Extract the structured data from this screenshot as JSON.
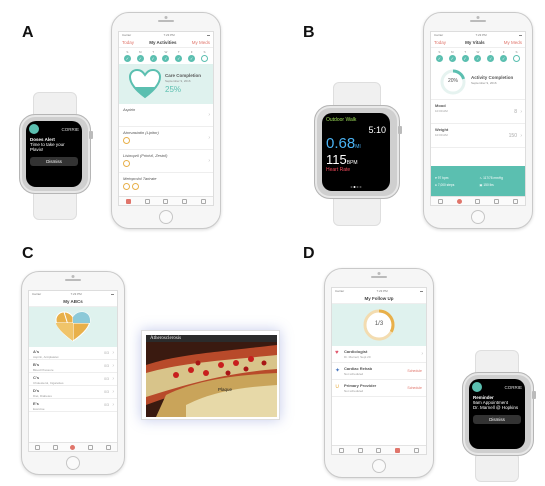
{
  "panels": {
    "a": {
      "letter": "A"
    },
    "b": {
      "letter": "B"
    },
    "c": {
      "letter": "C"
    },
    "d": {
      "letter": "D"
    }
  },
  "phone_a": {
    "status_left": "Carrier",
    "status_time": "7:23 PM",
    "nav_left": "Today",
    "nav_title": "My Activities",
    "nav_right": "My Meds",
    "days": [
      "S",
      "M",
      "T",
      "W",
      "T",
      "F",
      "S"
    ],
    "care_title": "Care Completion",
    "care_date": "September 9, 2016",
    "care_percent": "25%",
    "meds": [
      {
        "name": "Aspirin"
      },
      {
        "name": "Atorvastatin (Lipitor)"
      },
      {
        "name": "Lisinopril (Prinivil, Zestril)"
      },
      {
        "name": "Metoprolol Tartrate"
      }
    ]
  },
  "watch_a": {
    "app": "CORRIE",
    "line1": "Doses Alert",
    "line2": "Time to take your",
    "line3": "Plavix!",
    "button": "Dismiss"
  },
  "watch_b": {
    "title": "Outdoor Walk",
    "time": "5:10",
    "distance": "0.68",
    "distance_unit": "MI",
    "bpm": "115",
    "bpm_unit": "BPM",
    "hr_label": "Heart Rate"
  },
  "phone_b": {
    "status_left": "Carrier",
    "status_time": "7:23 PM",
    "nav_left": "Today",
    "nav_title": "My Vitals",
    "nav_right": "My Meds",
    "days": [
      "S",
      "M",
      "T",
      "W",
      "T",
      "F",
      "S"
    ],
    "activity_percent": "20%",
    "activity_title": "Activity Completion",
    "activity_date": "September 9, 2016",
    "vitals": [
      {
        "name": "Mood",
        "sub": "10:00 AM",
        "value": "8"
      },
      {
        "name": "Weight",
        "sub": "10:00 AM",
        "value": "150"
      }
    ],
    "summary": [
      "97 bpm",
      "117/78 mmHg",
      "7,000 steps",
      "150 lbs"
    ]
  },
  "phone_c": {
    "status_left": "Carrier",
    "status_time": "7:23 PM",
    "nav_title": "My ABCs",
    "items": [
      {
        "name": "A's",
        "sub": "Aspirin, Antiplatelet",
        "progress": "0/3"
      },
      {
        "name": "B's",
        "sub": "Blood Pressure",
        "progress": "0/3"
      },
      {
        "name": "C's",
        "sub": "Cholesterol, Cigarettes",
        "progress": "0/3"
      },
      {
        "name": "D's",
        "sub": "Diet, Diabetes",
        "progress": "0/3"
      },
      {
        "name": "E's",
        "sub": "Exercise",
        "progress": "0/3"
      }
    ]
  },
  "video": {
    "title": "Atherosclerosis",
    "label": "Plaque"
  },
  "phone_d": {
    "status_left": "Carrier",
    "status_time": "7:23 PM",
    "nav_title": "My Follow Up",
    "fraction": "1/3",
    "followups": [
      {
        "name": "Cardiologist",
        "sub": "Dr. Marnell, Sept 20",
        "action": ""
      },
      {
        "name": "Cardiac Rehab",
        "sub": "Not scheduled",
        "action": "Schedule"
      },
      {
        "name": "Primary Provider",
        "sub": "Not scheduled",
        "action": "Schedule"
      }
    ]
  },
  "watch_d": {
    "app": "CORRIE",
    "line1": "Reminder",
    "line2": "9am Appointment",
    "line3": "Dr. Marnell @ Hopkins",
    "button": "Dismiss"
  },
  "colors": {
    "accent": "#e0756b",
    "teal": "#5bbfb0",
    "teal_light": "#dff2ee",
    "orange": "#e8b04a"
  }
}
